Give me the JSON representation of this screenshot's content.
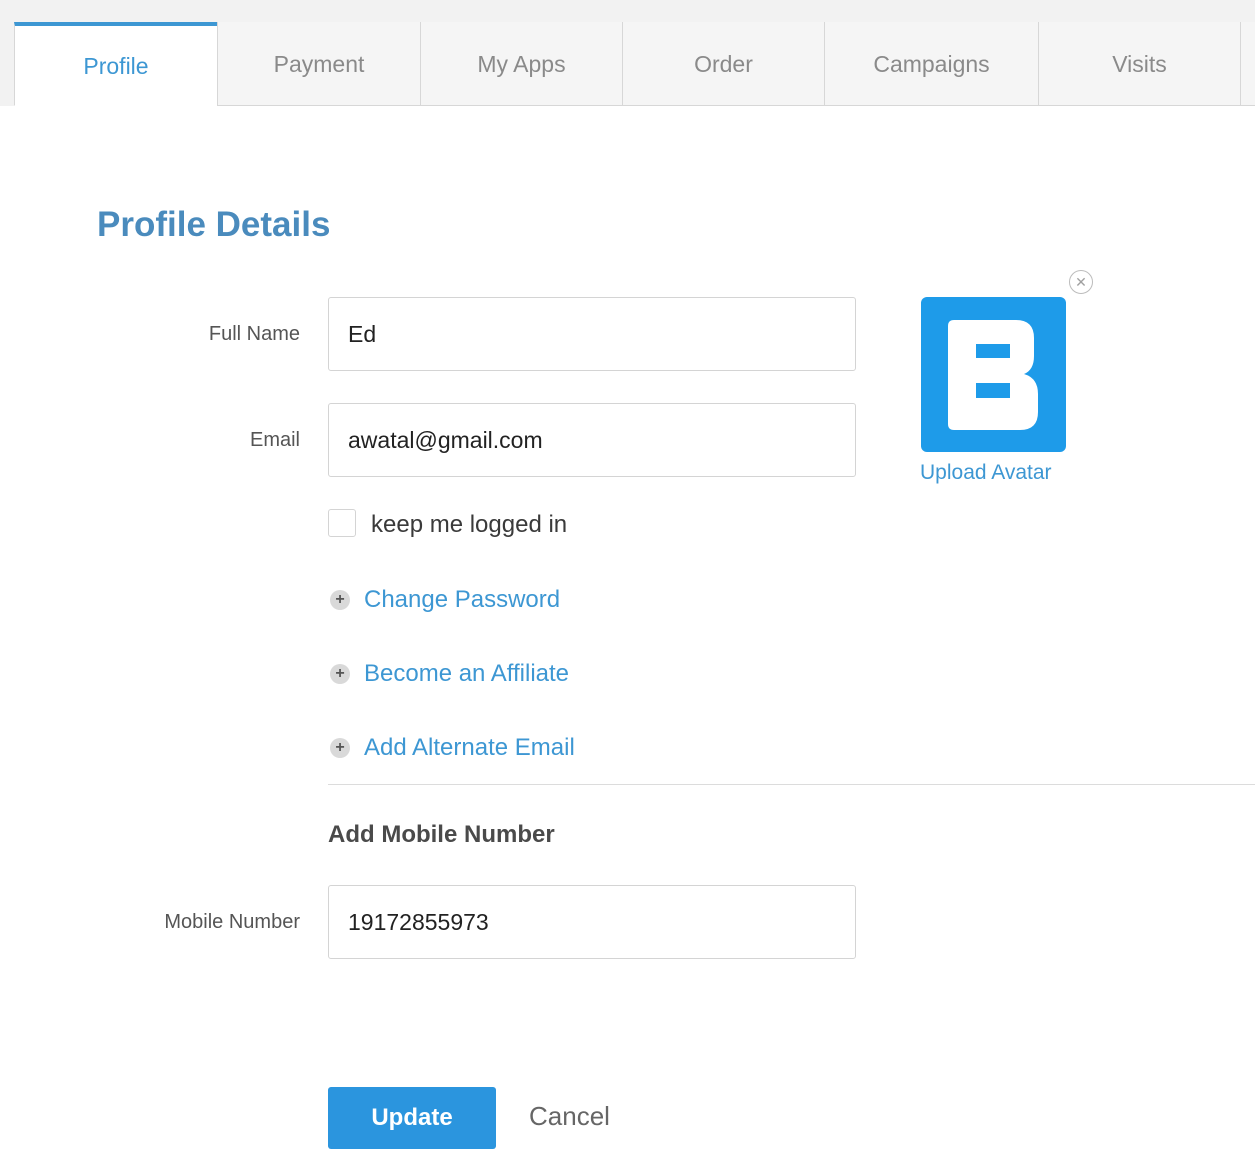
{
  "tabs": [
    {
      "label": "Profile",
      "active": true
    },
    {
      "label": "Payment",
      "active": false
    },
    {
      "label": "My Apps",
      "active": false
    },
    {
      "label": "Order",
      "active": false
    },
    {
      "label": "Campaigns",
      "active": false
    },
    {
      "label": "Visits",
      "active": false
    }
  ],
  "page": {
    "title": "Profile Details"
  },
  "form": {
    "full_name": {
      "label": "Full Name",
      "value": "Ed"
    },
    "email": {
      "label": "Email",
      "value": "awatal@gmail.com"
    },
    "keep_logged_in": {
      "label": "keep me logged in",
      "checked": false
    },
    "links": [
      {
        "label": "Change Password",
        "icon": "plus-circle-icon"
      },
      {
        "label": "Become an Affiliate",
        "icon": "plus-circle-icon"
      },
      {
        "label": "Add Alternate Email",
        "icon": "plus-circle-icon"
      }
    ],
    "mobile_section": {
      "heading": "Add Mobile Number"
    },
    "mobile": {
      "label": "Mobile Number",
      "value": "19172855973"
    }
  },
  "avatar": {
    "upload_label": "Upload Avatar",
    "logo_letter": "B",
    "background_color": "#1e9be9",
    "remove_icon": "close-circle-icon"
  },
  "actions": {
    "update_label": "Update",
    "cancel_label": "Cancel"
  },
  "colors": {
    "accent": "#3d97d3",
    "title": "#4a8bbd",
    "button": "#2b95de"
  }
}
